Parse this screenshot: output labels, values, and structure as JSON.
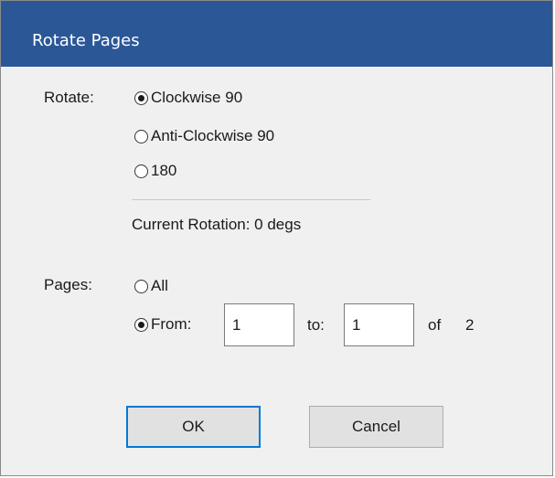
{
  "window": {
    "title": "Rotate Pages"
  },
  "rotate": {
    "label": "Rotate:",
    "options": [
      {
        "label": "Clockwise 90",
        "checked": true
      },
      {
        "label": "Anti-Clockwise 90",
        "checked": false
      },
      {
        "label": "180",
        "checked": false
      }
    ],
    "current_rotation": "Current Rotation:  0 degs"
  },
  "pages": {
    "label": "Pages:",
    "options": [
      {
        "label": "All",
        "checked": false
      },
      {
        "label": "From:",
        "checked": true
      }
    ],
    "from_value": "1",
    "to_label": "to:",
    "to_value": "1",
    "of_label": "of",
    "total": "2"
  },
  "buttons": {
    "ok": "OK",
    "cancel": "Cancel"
  },
  "colors": {
    "titlebar": "#2b5797",
    "default_button_border": "#0078d7"
  }
}
